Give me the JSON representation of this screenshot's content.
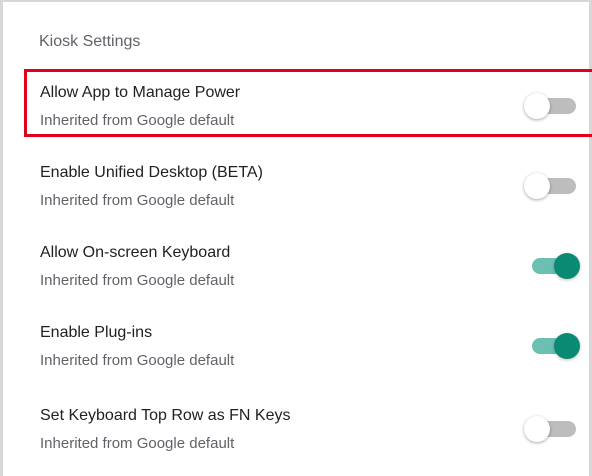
{
  "section": {
    "title": "Kiosk Settings"
  },
  "colors": {
    "toggle_on_track": "#6cc0b2",
    "toggle_on_knob": "#0b8a73",
    "toggle_off_track": "#bdbdbd",
    "highlight": "#e0001b"
  },
  "settings": [
    {
      "label": "Allow App to Manage Power",
      "sublabel": "Inherited from Google default",
      "enabled": false,
      "highlighted": true
    },
    {
      "label": "Enable Unified Desktop (BETA)",
      "sublabel": "Inherited from Google default",
      "enabled": false,
      "highlighted": false
    },
    {
      "label": "Allow On-screen Keyboard",
      "sublabel": "Inherited from Google default",
      "enabled": true,
      "highlighted": false
    },
    {
      "label": "Enable Plug-ins",
      "sublabel": "Inherited from Google default",
      "enabled": true,
      "highlighted": false
    },
    {
      "label": "Set Keyboard Top Row as FN Keys",
      "sublabel": "Inherited from Google default",
      "enabled": false,
      "highlighted": false
    }
  ]
}
